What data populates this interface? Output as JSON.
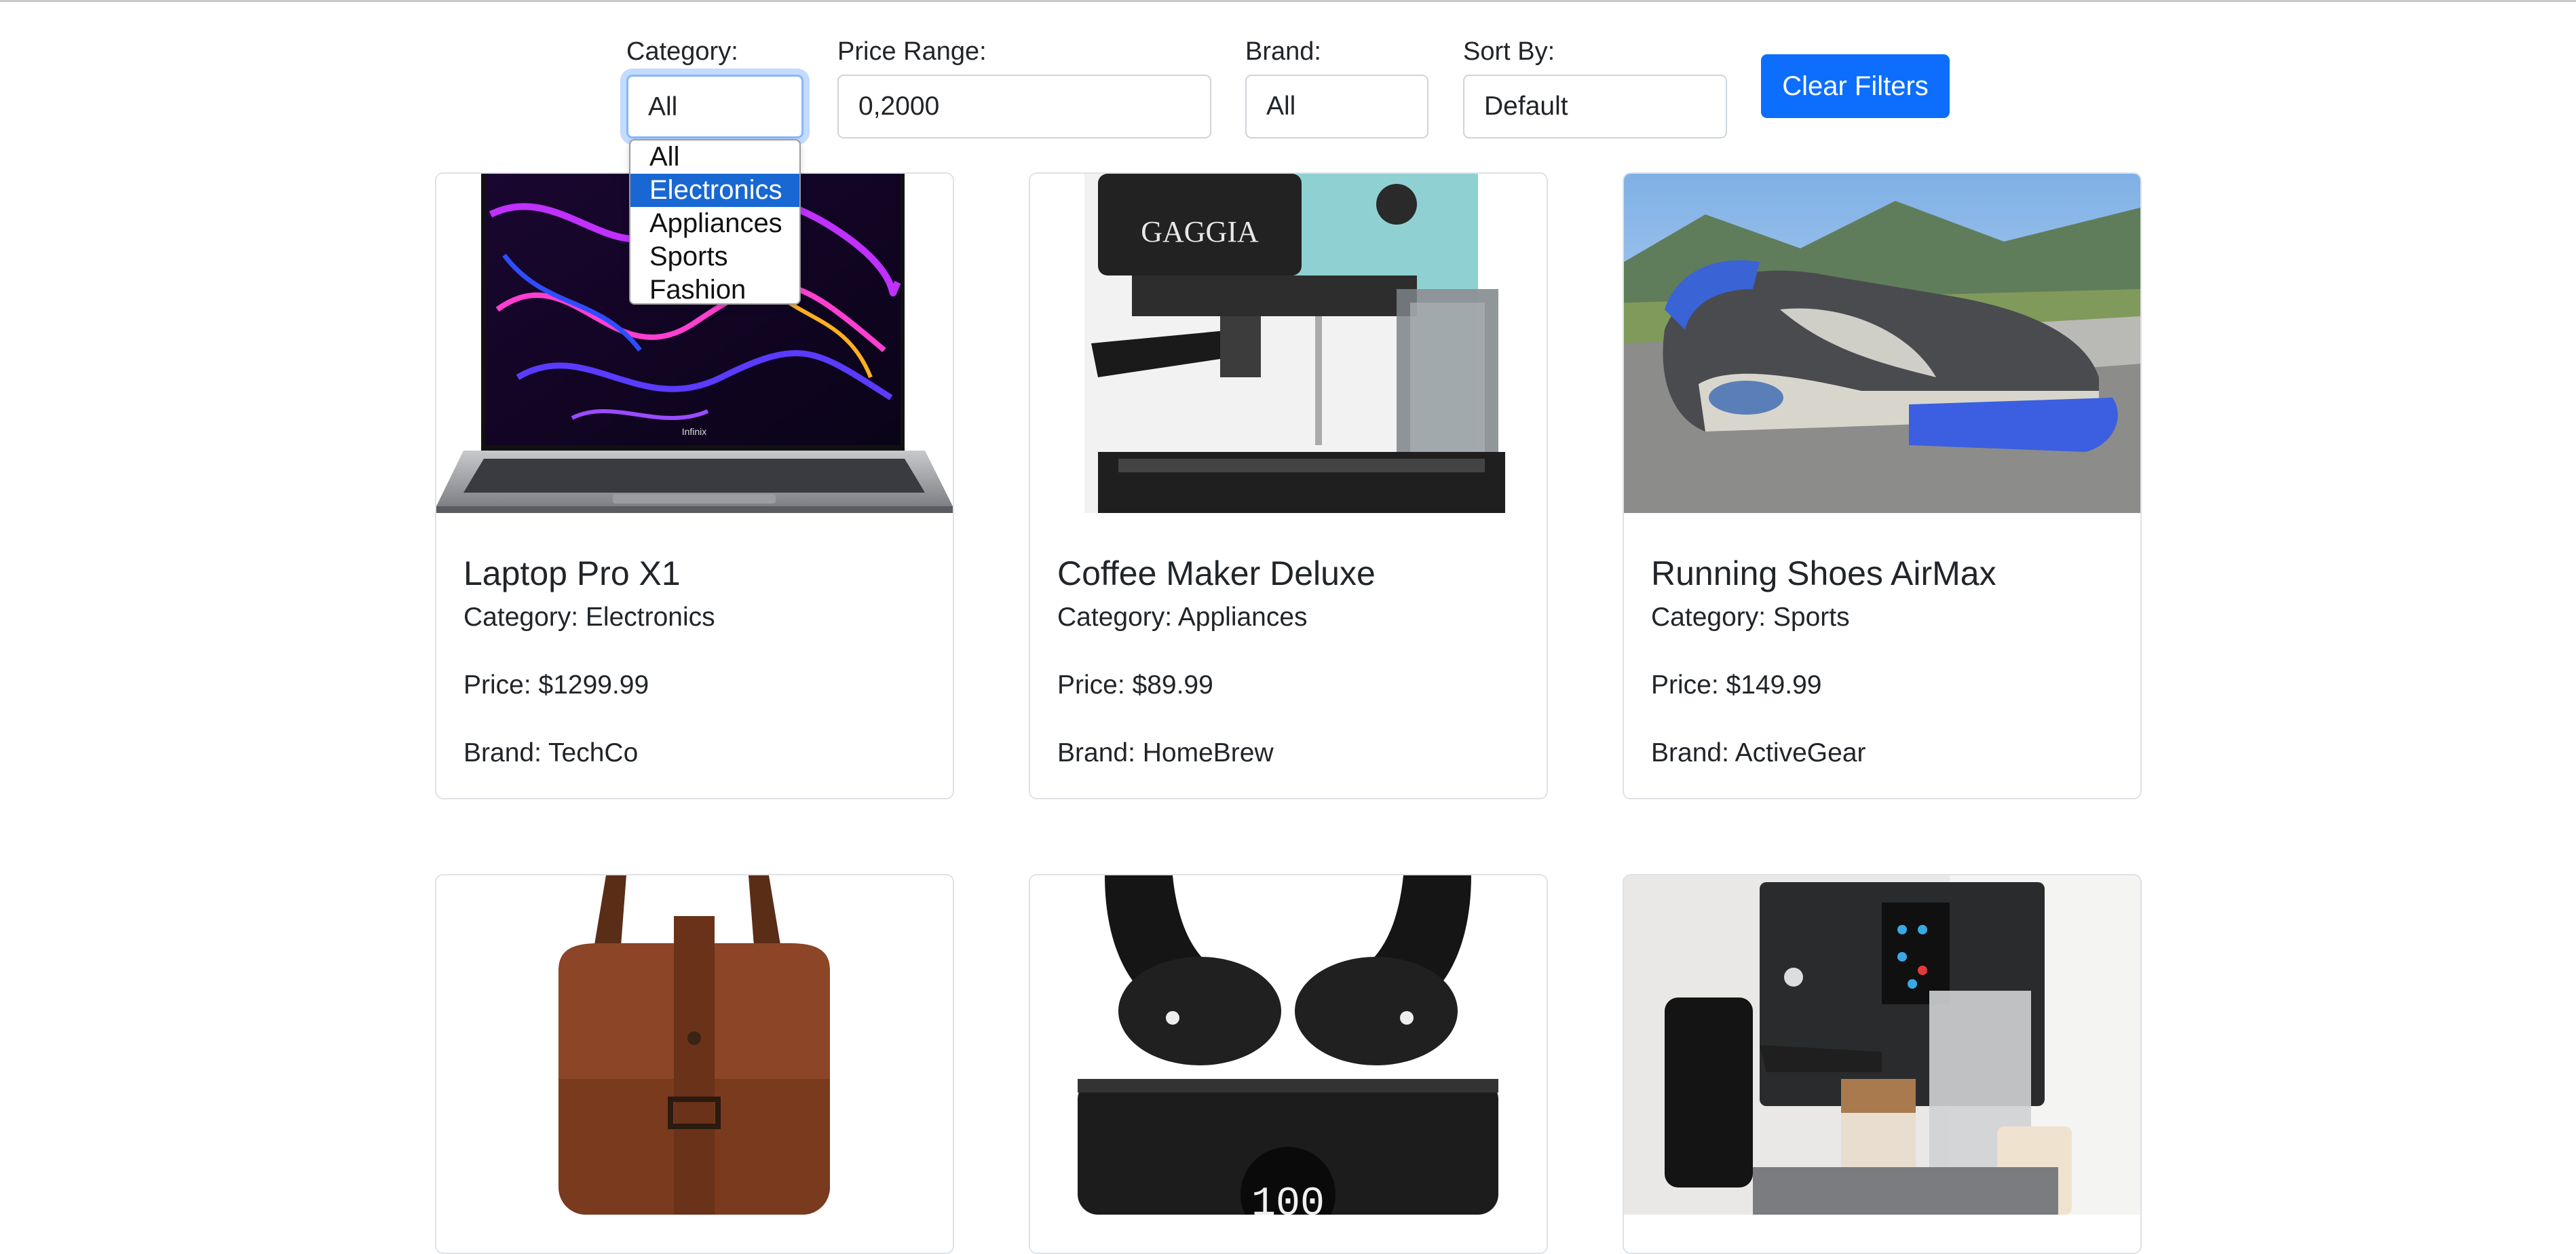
{
  "filters": {
    "category": {
      "label": "Category:",
      "value": "All",
      "options": [
        "All",
        "Electronics",
        "Appliances",
        "Sports",
        "Fashion"
      ],
      "highlighted_option": "Electronics"
    },
    "price_range": {
      "label": "Price Range:",
      "value": "0,2000"
    },
    "brand": {
      "label": "Brand:",
      "value": "All"
    },
    "sort_by": {
      "label": "Sort By:",
      "value": "Default"
    },
    "clear_label": "Clear Filters"
  },
  "colors": {
    "accent": "#0d6efd",
    "focus_border": "#86b7fe",
    "dropdown_highlight": "#1967d2",
    "border": "#dee2e6",
    "text": "#212529"
  },
  "products": [
    {
      "title": "Laptop Pro X1",
      "category": "Category: Electronics",
      "price": "Price: $1299.99",
      "brand": "Brand: TechCo",
      "image": "laptop-image",
      "logo_text": "Infinix"
    },
    {
      "title": "Coffee Maker Deluxe",
      "category": "Category: Appliances",
      "price": "Price: $89.99",
      "brand": "Brand: HomeBrew",
      "image": "coffee-maker-image",
      "logo_text": "GAGGIA"
    },
    {
      "title": "Running Shoes AirMax",
      "category": "Category: Sports",
      "price": "Price: $149.99",
      "brand": "Brand: ActiveGear",
      "image": "running-shoe-image"
    },
    {
      "image": "leather-backpack-image"
    },
    {
      "image": "wireless-earbuds-image",
      "display_text": "100"
    },
    {
      "image": "espresso-machine-image"
    }
  ]
}
